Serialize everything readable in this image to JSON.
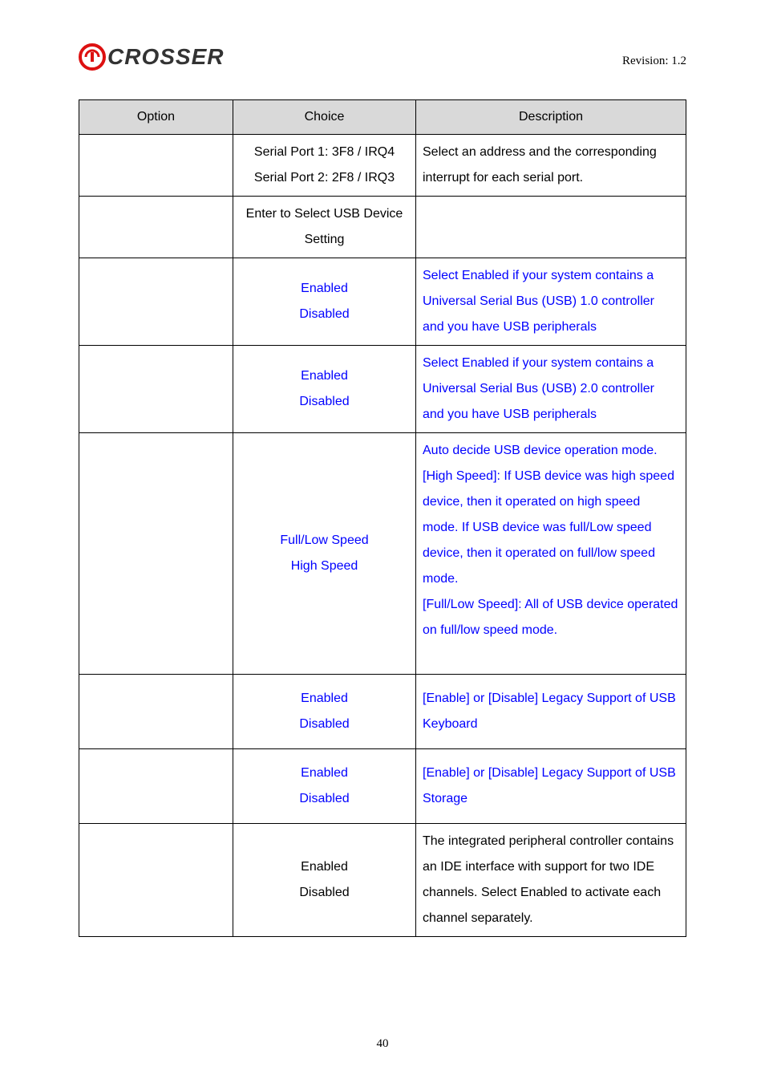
{
  "header": {
    "logo_text": "CROSSER",
    "revision": "Revision: 1.2"
  },
  "table": {
    "headers": {
      "c1": "Option",
      "c2": "Choice",
      "c3": "Description"
    },
    "rows": [
      {
        "choice_lines": [
          "Serial Port 1: 3F8 / IRQ4",
          "Serial Port 2: 2F8 / IRQ3"
        ],
        "choice_color": "black",
        "desc_lines": [
          "Select an address and the corresponding interrupt for each serial port."
        ],
        "desc_color": "black"
      },
      {
        "choice_lines": [
          "Enter to Select USB Device Setting"
        ],
        "choice_color": "black",
        "desc_lines": [
          ""
        ],
        "desc_color": "black",
        "tall": true
      },
      {
        "choice_lines": [
          "Enabled",
          "Disabled"
        ],
        "choice_color": "blue",
        "desc_lines": [
          "Select Enabled if your system contains a Universal Serial Bus (USB) 1.0 controller and you have USB peripherals"
        ],
        "desc_color": "blue"
      },
      {
        "choice_lines": [
          "Enabled",
          "Disabled"
        ],
        "choice_color": "blue",
        "desc_lines": [
          "Select Enabled if your system contains a Universal Serial Bus (USB) 2.0 controller and you have USB peripherals"
        ],
        "desc_color": "blue"
      },
      {
        "choice_lines": [
          "Full/Low Speed",
          "High Speed"
        ],
        "choice_color": "blue",
        "desc_lines": [
          "Auto decide USB device operation mode.",
          "[High Speed]: If USB device was high speed device, then it operated on high speed mode. If USB device was full/Low speed device, then it operated on full/low speed mode.",
          "[Full/Low Speed]: All of USB device operated on full/low speed mode.",
          ""
        ],
        "desc_color": "blue"
      },
      {
        "choice_lines": [
          "Enabled",
          "Disabled"
        ],
        "choice_color": "blue",
        "desc_lines": [
          "[Enable] or [Disable] Legacy Support of USB Keyboard"
        ],
        "desc_color": "blue",
        "pad": true
      },
      {
        "choice_lines": [
          "Enabled",
          "Disabled"
        ],
        "choice_color": "blue",
        "desc_lines": [
          "[Enable] or [Disable] Legacy Support of USB Storage"
        ],
        "desc_color": "blue",
        "pad": true
      },
      {
        "choice_lines": [
          "Enabled",
          "Disabled"
        ],
        "choice_color": "black",
        "desc_lines": [
          "The integrated peripheral controller contains an IDE interface with support for two IDE channels. Select Enabled to activate each channel separately."
        ],
        "desc_color": "black"
      }
    ]
  },
  "page_number": "40"
}
